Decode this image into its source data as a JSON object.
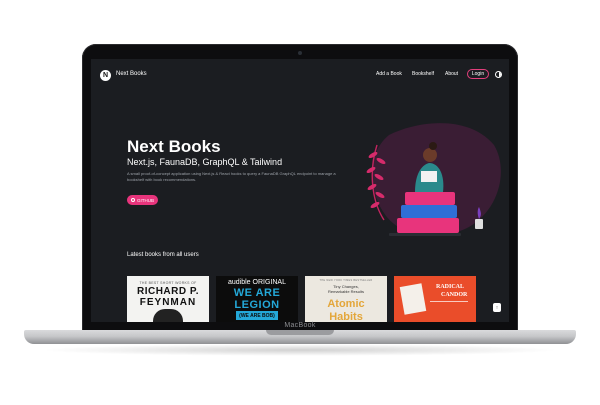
{
  "device": {
    "label": "MacBook"
  },
  "nav": {
    "logo_letter": "N",
    "brand": "Next Books",
    "links": [
      "Add a Book",
      "Bookshelf",
      "About"
    ],
    "login_label": "Login",
    "theme_icon": "half-circle-icon"
  },
  "hero": {
    "title": "Next Books",
    "subtitle": "Next.js, FaunaDB, GraphQL & Tailwind",
    "description": "A small proof-of-concept application using Next.js & React hooks to query a FaunaDB GraphQL endpoint to manage a bookshelf with book recommendations.",
    "github_label": "GITHUB"
  },
  "books_section": {
    "title": "Latest books from all users",
    "books": [
      {
        "top": "THE BEST SHORT WORKS OF",
        "line1": "RICHARD P.",
        "line2": "FEYNMAN"
      },
      {
        "top": "audible ORIGINAL",
        "line1": "WE ARE",
        "line2": "LEGION",
        "line3": "(WE ARE BOB)"
      },
      {
        "top": "THE NEW YORK TIMES BESTSELLER",
        "line1": "Tiny Changes,",
        "line2": "Remarkable Results",
        "line3": "Atomic",
        "line4": "Habits"
      },
      {
        "line1": "RADICAL",
        "line2": "CANDOR"
      }
    ]
  },
  "colors": {
    "accent": "#e8347c",
    "bg": "#1b1d21"
  }
}
